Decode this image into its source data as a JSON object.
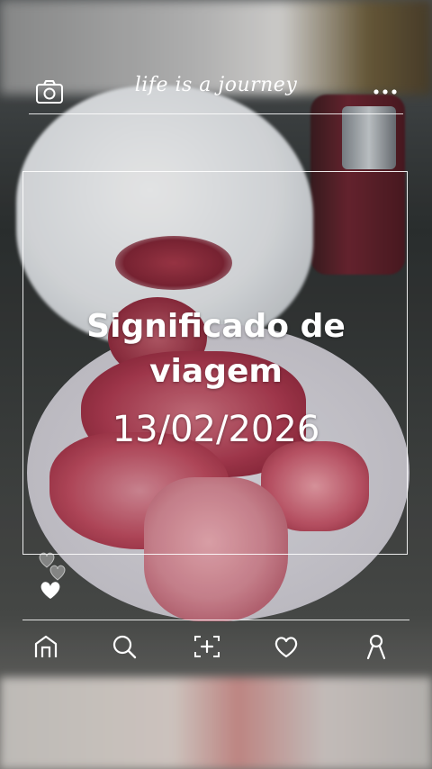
{
  "header": {
    "brand": "life is a journey",
    "left_icon": "camera-icon",
    "right_icon": "more-dots-icon"
  },
  "content": {
    "title_line1": "Significado de",
    "title_line2": "viagem",
    "date": "13/02/2026"
  },
  "reactions": {
    "icons": [
      "heart-outline-icon",
      "heart-outline-icon",
      "heart-filled-icon"
    ]
  },
  "bottom_nav": {
    "items": [
      {
        "name": "home",
        "icon": "home-icon"
      },
      {
        "name": "search",
        "icon": "search-icon"
      },
      {
        "name": "add",
        "icon": "add-frame-icon"
      },
      {
        "name": "likes",
        "icon": "heart-icon"
      },
      {
        "name": "profile",
        "icon": "profile-icon"
      }
    ]
  },
  "colors": {
    "overlay_text": "#ffffff",
    "lines": "#ffffff"
  }
}
